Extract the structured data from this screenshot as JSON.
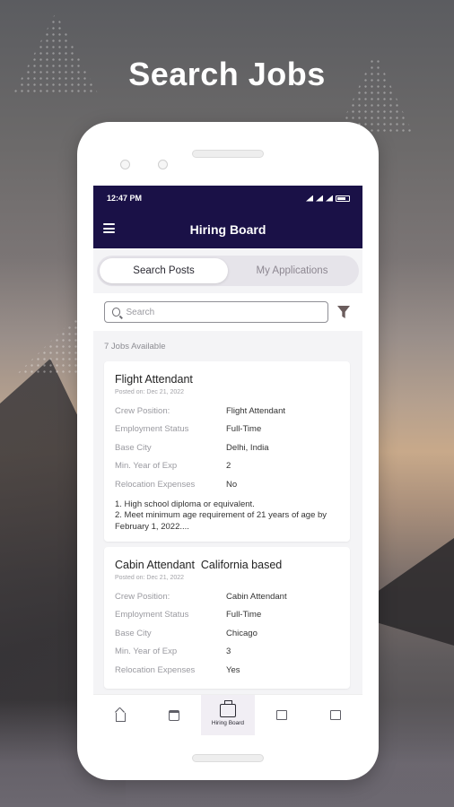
{
  "headline": "Search Jobs",
  "status_bar": {
    "time": "12:47 PM"
  },
  "app_bar": {
    "title": "Hiring Board"
  },
  "tabs": [
    {
      "label": "Search Posts",
      "active": true
    },
    {
      "label": "My Applications",
      "active": false
    }
  ],
  "search": {
    "placeholder": "Search",
    "value": ""
  },
  "jobs_count": "7 Jobs Available",
  "jobs": [
    {
      "title": "Flight Attendant",
      "posted": "Posted on: Dec 21, 2022",
      "fields": [
        {
          "label": "Crew Position:",
          "value": "Flight Attendant"
        },
        {
          "label": "Employment Status",
          "value": "Full-Time"
        },
        {
          "label": "Base City",
          "value": "Delhi, India"
        },
        {
          "label": "Min. Year of Exp",
          "value": "2"
        },
        {
          "label": "Relocation Expenses",
          "value": "No"
        }
      ],
      "description": "1. High school diploma or equivalent.\n2. Meet minimum age requirement of 21 years of age by February 1, 2022...."
    },
    {
      "title": "Cabin Attendant  California based",
      "posted": "Posted on: Dec 21, 2022",
      "fields": [
        {
          "label": "Crew Position:",
          "value": "Cabin Attendant"
        },
        {
          "label": "Employment Status",
          "value": "Full-Time"
        },
        {
          "label": "Base City",
          "value": "Chicago"
        },
        {
          "label": "Min. Year of Exp",
          "value": "3"
        },
        {
          "label": "Relocation Expenses",
          "value": "Yes"
        }
      ],
      "description": ""
    }
  ],
  "bottom_nav": [
    {
      "icon": "home-icon",
      "label": ""
    },
    {
      "icon": "calendar-icon",
      "label": ""
    },
    {
      "icon": "briefcase-icon",
      "label": "Hiring Board",
      "active": true
    },
    {
      "icon": "chat-icon",
      "label": ""
    },
    {
      "icon": "building-icon",
      "label": ""
    }
  ],
  "colors": {
    "app_bar": "#1a1147",
    "accent_filter": "#6b5d5d"
  }
}
